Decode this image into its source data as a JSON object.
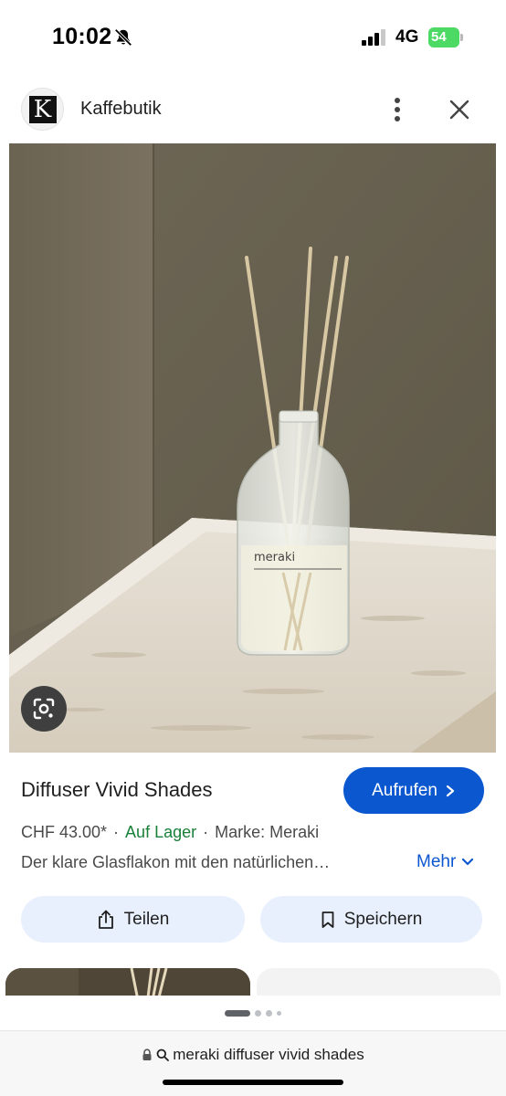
{
  "status_bar": {
    "time": "10:02",
    "network": "4G",
    "battery": "54",
    "icons": [
      "bell-slash-icon",
      "signal-icon",
      "battery-charging-icon"
    ]
  },
  "header": {
    "logo_letter": "K",
    "site_name": "Kaffebutik",
    "icons": [
      "more-vert-icon",
      "close-icon"
    ]
  },
  "product": {
    "title": "Diffuser Vivid Shades",
    "visit_label": "Aufrufen",
    "price": "CHF 43.00*",
    "stock": "Auf Lager",
    "brand": "Marke: Meraki",
    "description": "Der klare Glasflakon mit den natürlichen…",
    "more_label": "Mehr",
    "bottle_label": "meraki"
  },
  "actions": {
    "share_label": "Teilen",
    "save_label": "Speichern"
  },
  "address_bar": {
    "query": "meraki diffuser vivid shades"
  },
  "colors": {
    "accent": "#0b57d0",
    "stock_green": "#188038",
    "pill_bg": "#e8f0fe",
    "battery_green": "#4cd964"
  }
}
